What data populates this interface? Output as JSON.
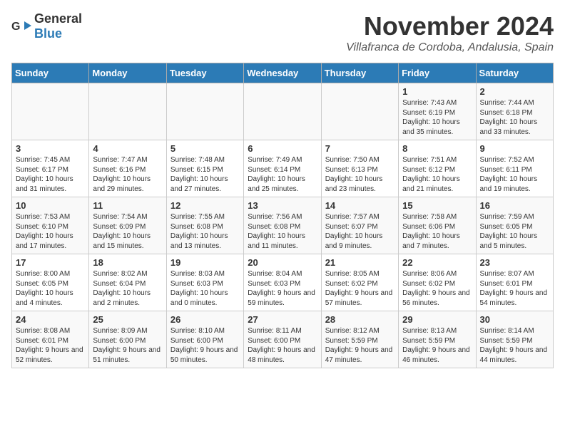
{
  "header": {
    "logo_general": "General",
    "logo_blue": "Blue",
    "title": "November 2024",
    "location": "Villafranca de Cordoba, Andalusia, Spain"
  },
  "weekdays": [
    "Sunday",
    "Monday",
    "Tuesday",
    "Wednesday",
    "Thursday",
    "Friday",
    "Saturday"
  ],
  "weeks": [
    [
      {
        "day": "",
        "info": ""
      },
      {
        "day": "",
        "info": ""
      },
      {
        "day": "",
        "info": ""
      },
      {
        "day": "",
        "info": ""
      },
      {
        "day": "",
        "info": ""
      },
      {
        "day": "1",
        "info": "Sunrise: 7:43 AM\nSunset: 6:19 PM\nDaylight: 10 hours and 35 minutes."
      },
      {
        "day": "2",
        "info": "Sunrise: 7:44 AM\nSunset: 6:18 PM\nDaylight: 10 hours and 33 minutes."
      }
    ],
    [
      {
        "day": "3",
        "info": "Sunrise: 7:45 AM\nSunset: 6:17 PM\nDaylight: 10 hours and 31 minutes."
      },
      {
        "day": "4",
        "info": "Sunrise: 7:47 AM\nSunset: 6:16 PM\nDaylight: 10 hours and 29 minutes."
      },
      {
        "day": "5",
        "info": "Sunrise: 7:48 AM\nSunset: 6:15 PM\nDaylight: 10 hours and 27 minutes."
      },
      {
        "day": "6",
        "info": "Sunrise: 7:49 AM\nSunset: 6:14 PM\nDaylight: 10 hours and 25 minutes."
      },
      {
        "day": "7",
        "info": "Sunrise: 7:50 AM\nSunset: 6:13 PM\nDaylight: 10 hours and 23 minutes."
      },
      {
        "day": "8",
        "info": "Sunrise: 7:51 AM\nSunset: 6:12 PM\nDaylight: 10 hours and 21 minutes."
      },
      {
        "day": "9",
        "info": "Sunrise: 7:52 AM\nSunset: 6:11 PM\nDaylight: 10 hours and 19 minutes."
      }
    ],
    [
      {
        "day": "10",
        "info": "Sunrise: 7:53 AM\nSunset: 6:10 PM\nDaylight: 10 hours and 17 minutes."
      },
      {
        "day": "11",
        "info": "Sunrise: 7:54 AM\nSunset: 6:09 PM\nDaylight: 10 hours and 15 minutes."
      },
      {
        "day": "12",
        "info": "Sunrise: 7:55 AM\nSunset: 6:08 PM\nDaylight: 10 hours and 13 minutes."
      },
      {
        "day": "13",
        "info": "Sunrise: 7:56 AM\nSunset: 6:08 PM\nDaylight: 10 hours and 11 minutes."
      },
      {
        "day": "14",
        "info": "Sunrise: 7:57 AM\nSunset: 6:07 PM\nDaylight: 10 hours and 9 minutes."
      },
      {
        "day": "15",
        "info": "Sunrise: 7:58 AM\nSunset: 6:06 PM\nDaylight: 10 hours and 7 minutes."
      },
      {
        "day": "16",
        "info": "Sunrise: 7:59 AM\nSunset: 6:05 PM\nDaylight: 10 hours and 5 minutes."
      }
    ],
    [
      {
        "day": "17",
        "info": "Sunrise: 8:00 AM\nSunset: 6:05 PM\nDaylight: 10 hours and 4 minutes."
      },
      {
        "day": "18",
        "info": "Sunrise: 8:02 AM\nSunset: 6:04 PM\nDaylight: 10 hours and 2 minutes."
      },
      {
        "day": "19",
        "info": "Sunrise: 8:03 AM\nSunset: 6:03 PM\nDaylight: 10 hours and 0 minutes."
      },
      {
        "day": "20",
        "info": "Sunrise: 8:04 AM\nSunset: 6:03 PM\nDaylight: 9 hours and 59 minutes."
      },
      {
        "day": "21",
        "info": "Sunrise: 8:05 AM\nSunset: 6:02 PM\nDaylight: 9 hours and 57 minutes."
      },
      {
        "day": "22",
        "info": "Sunrise: 8:06 AM\nSunset: 6:02 PM\nDaylight: 9 hours and 56 minutes."
      },
      {
        "day": "23",
        "info": "Sunrise: 8:07 AM\nSunset: 6:01 PM\nDaylight: 9 hours and 54 minutes."
      }
    ],
    [
      {
        "day": "24",
        "info": "Sunrise: 8:08 AM\nSunset: 6:01 PM\nDaylight: 9 hours and 52 minutes."
      },
      {
        "day": "25",
        "info": "Sunrise: 8:09 AM\nSunset: 6:00 PM\nDaylight: 9 hours and 51 minutes."
      },
      {
        "day": "26",
        "info": "Sunrise: 8:10 AM\nSunset: 6:00 PM\nDaylight: 9 hours and 50 minutes."
      },
      {
        "day": "27",
        "info": "Sunrise: 8:11 AM\nSunset: 6:00 PM\nDaylight: 9 hours and 48 minutes."
      },
      {
        "day": "28",
        "info": "Sunrise: 8:12 AM\nSunset: 5:59 PM\nDaylight: 9 hours and 47 minutes."
      },
      {
        "day": "29",
        "info": "Sunrise: 8:13 AM\nSunset: 5:59 PM\nDaylight: 9 hours and 46 minutes."
      },
      {
        "day": "30",
        "info": "Sunrise: 8:14 AM\nSunset: 5:59 PM\nDaylight: 9 hours and 44 minutes."
      }
    ]
  ]
}
